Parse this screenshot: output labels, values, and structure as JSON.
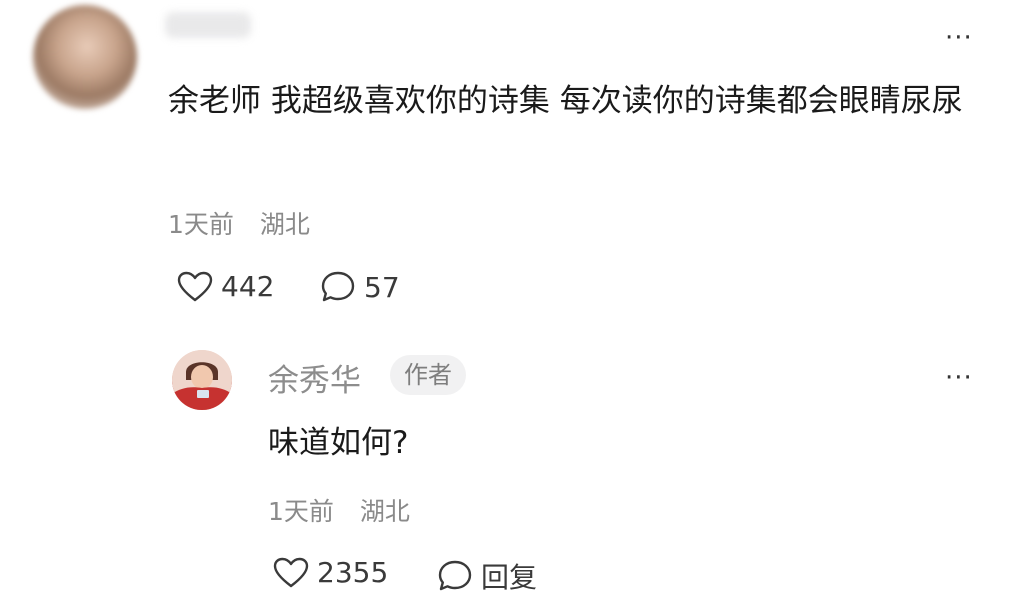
{
  "comment": {
    "text": "余老师 我超级喜欢你的诗集 每次读你的诗集都会眼睛尿尿",
    "time": "1天前",
    "location": "湖北",
    "likes": "442",
    "replies": "57",
    "more": "···"
  },
  "reply": {
    "author": "余秀华",
    "badge": "作者",
    "text": "味道如何?",
    "time": "1天前",
    "location": "湖北",
    "likes": "2355",
    "reply_label": "回复",
    "more": "···"
  },
  "icons": {
    "like": "heart-outline-icon",
    "comment": "speech-bubble-icon",
    "more": "ellipsis-icon"
  }
}
